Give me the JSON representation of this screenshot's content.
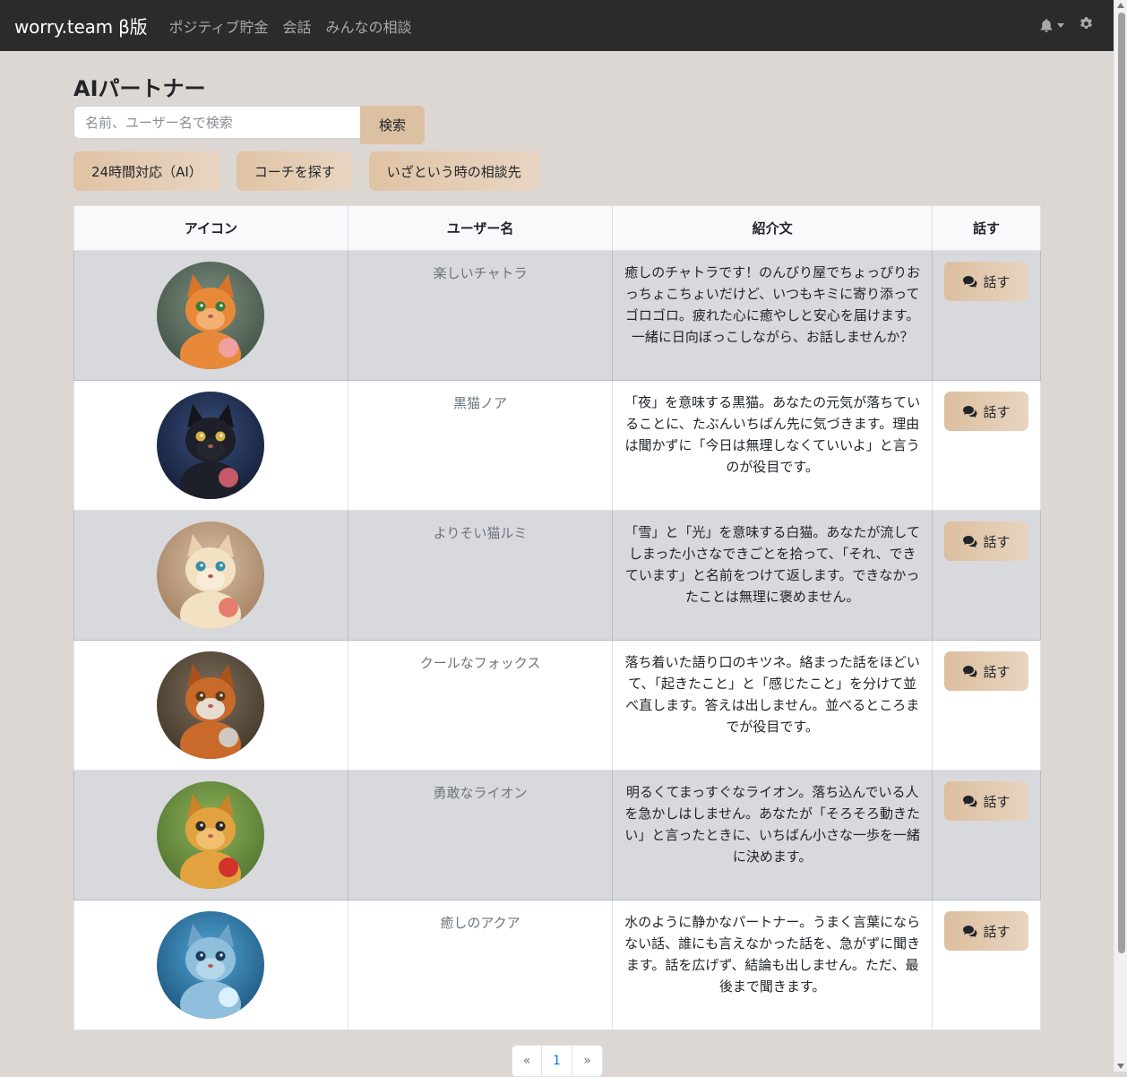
{
  "nav": {
    "brand": "worry.team β版",
    "links": [
      "ポジティブ貯金",
      "会話",
      "みんなの相談"
    ],
    "icons": [
      "bell-icon",
      "gear-icon"
    ]
  },
  "page": {
    "title": "AIパートナー",
    "search_placeholder": "名前、ユーザー名で検索",
    "search_button": "検索",
    "filters": [
      "24時間対応（AI）",
      "コーチを探す",
      "いざという時の相談先"
    ]
  },
  "table": {
    "headers": [
      "アイコン",
      "ユーザー名",
      "紹介文",
      "話す"
    ],
    "talk_label": "話す",
    "rows": [
      {
        "username": "楽しいチャトラ",
        "intro": "癒しのチャトラです！のんびり屋でちょっぴりおっちょこちょいだけど、いつもキミに寄り添ってゴロゴロ。疲れた心に癒やしと安心を届けます。一緒に日向ぼっこしながら、お話しませんか？",
        "avatar": "orange-cat-avatar"
      },
      {
        "username": "黒猫ノア",
        "intro": "「夜」を意味する黒猫。あなたの元気が落ちていることに、たぶんいちばん先に気づきます。理由は聞かずに「今日は無理しなくていいよ」と言うのが役目です。",
        "avatar": "black-cat-avatar"
      },
      {
        "username": "よりそい猫ルミ",
        "intro": "「雪」と「光」を意味する白猫。あなたが流してしまった小さなできごとを拾って、「それ、できています」と名前をつけて返します。できなかったことは無理に褒めません。",
        "avatar": "white-cat-avatar"
      },
      {
        "username": "クールなフォックス",
        "intro": "落ち着いた語り口のキツネ。絡まった話をほどいて、「起きたこと」と「感じたこと」を分けて並べ直します。答えは出しません。並べるところまでが役目です。",
        "avatar": "fox-avatar"
      },
      {
        "username": "勇敢なライオン",
        "intro": "明るくてまっすぐなライオン。落ち込んでいる人を急かしはしません。あなたが「そろそろ動きたい」と言ったときに、いちばん小さな一歩を一緒に決めます。",
        "avatar": "lion-avatar"
      },
      {
        "username": "癒しのアクア",
        "intro": "水のように静かなパートナー。うまく言葉にならない話、誰にも言えなかった話を、急がずに聞きます。話を広げず、結論も出しません。ただ、最後まで聞きます。",
        "avatar": "aqua-avatar"
      }
    ]
  },
  "pagination": {
    "prev": "«",
    "current": "1",
    "next": "»"
  },
  "colors": {
    "navbar": "#2b2b2b",
    "background": "#ddd7d3",
    "accent": "#dcc0a2"
  }
}
